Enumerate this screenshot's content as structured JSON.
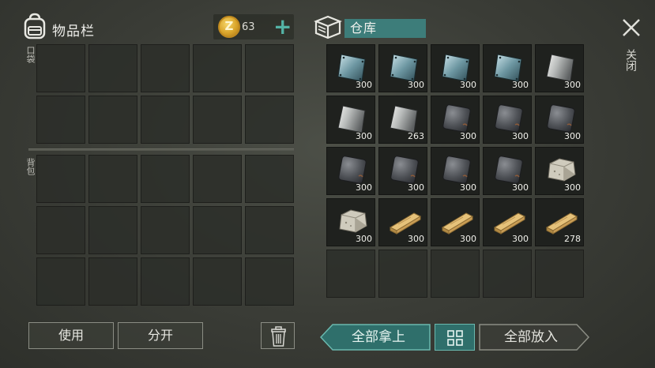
{
  "inventory": {
    "title": "物品栏",
    "coins": "63",
    "pocket_label": "口袋",
    "backpack_label": "背包"
  },
  "warehouse": {
    "title": "仓库",
    "items": [
      {
        "type": "glass",
        "qty": "300"
      },
      {
        "type": "glass",
        "qty": "300"
      },
      {
        "type": "glass",
        "qty": "300"
      },
      {
        "type": "glass",
        "qty": "300"
      },
      {
        "type": "steel",
        "qty": "300"
      },
      {
        "type": "steel",
        "qty": "300"
      },
      {
        "type": "steel",
        "qty": "263"
      },
      {
        "type": "iron",
        "qty": "300"
      },
      {
        "type": "iron",
        "qty": "300"
      },
      {
        "type": "iron",
        "qty": "300"
      },
      {
        "type": "iron",
        "qty": "300"
      },
      {
        "type": "iron",
        "qty": "300"
      },
      {
        "type": "iron",
        "qty": "300"
      },
      {
        "type": "iron",
        "qty": "300"
      },
      {
        "type": "stone",
        "qty": "300"
      },
      {
        "type": "stone",
        "qty": "300"
      },
      {
        "type": "wood",
        "qty": "300"
      },
      {
        "type": "wood",
        "qty": "300"
      },
      {
        "type": "wood",
        "qty": "300"
      },
      {
        "type": "wood",
        "qty": "278"
      }
    ]
  },
  "close_label": "关闭",
  "buttons": {
    "use": "使用",
    "split": "分开",
    "take_all": "全部拿上",
    "put_all": "全部放入"
  },
  "icons": {
    "bag": "backpack-icon",
    "coin": "coin-icon",
    "plus": "plus-icon",
    "box": "storage-box-icon",
    "close": "close-icon",
    "trash": "trash-icon",
    "grid": "grid-view-icon"
  },
  "colors": {
    "accent": "#3d7d7a",
    "plus": "#54b3a6"
  }
}
